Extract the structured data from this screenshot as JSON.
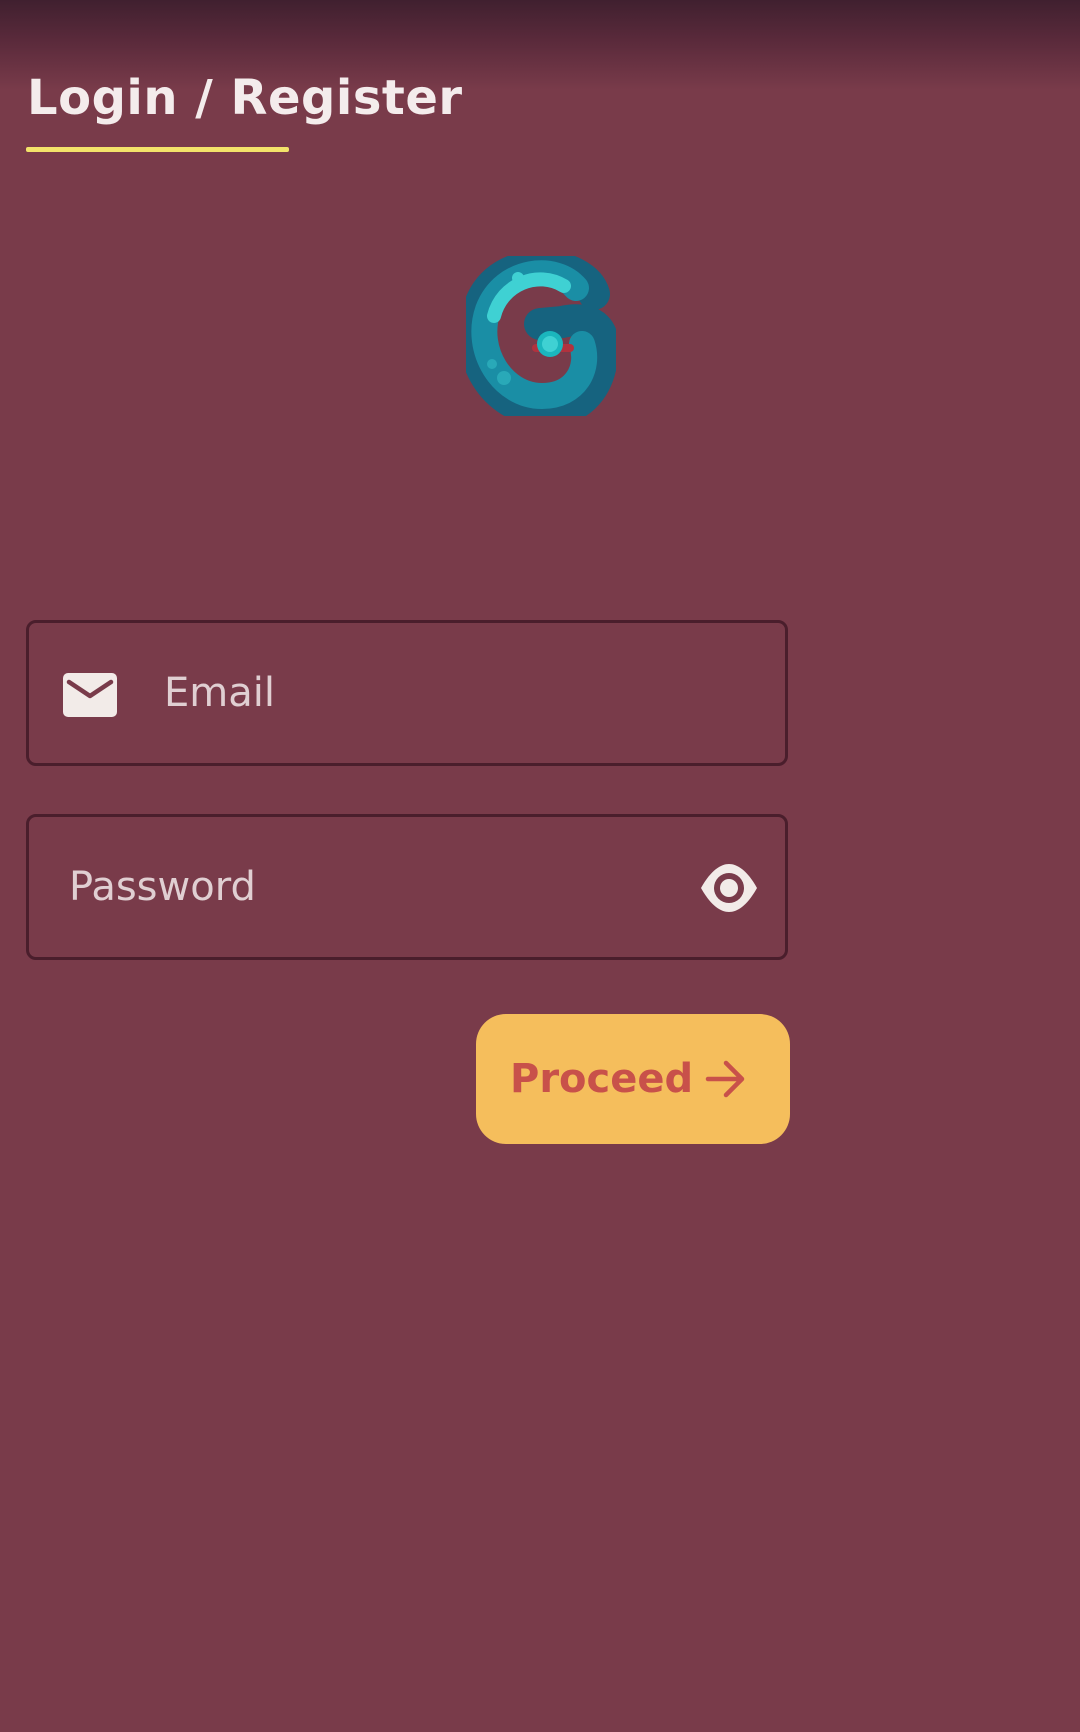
{
  "header": {
    "title": "Login / Register"
  },
  "logo": {
    "icon": "g-logo-icon"
  },
  "form": {
    "email": {
      "placeholder": "Email",
      "value": "",
      "icon": "mail-icon"
    },
    "password": {
      "placeholder": "Password",
      "value": "",
      "icon": "eye-icon"
    },
    "proceed_label": "Proceed",
    "proceed_icon": "arrow-right-icon"
  },
  "colors": {
    "background": "#793b4a",
    "title_underline": "#f3e36a",
    "button_fill": "#f5be5c",
    "button_text": "#c8514a",
    "field_border": "#4a1e2c"
  }
}
